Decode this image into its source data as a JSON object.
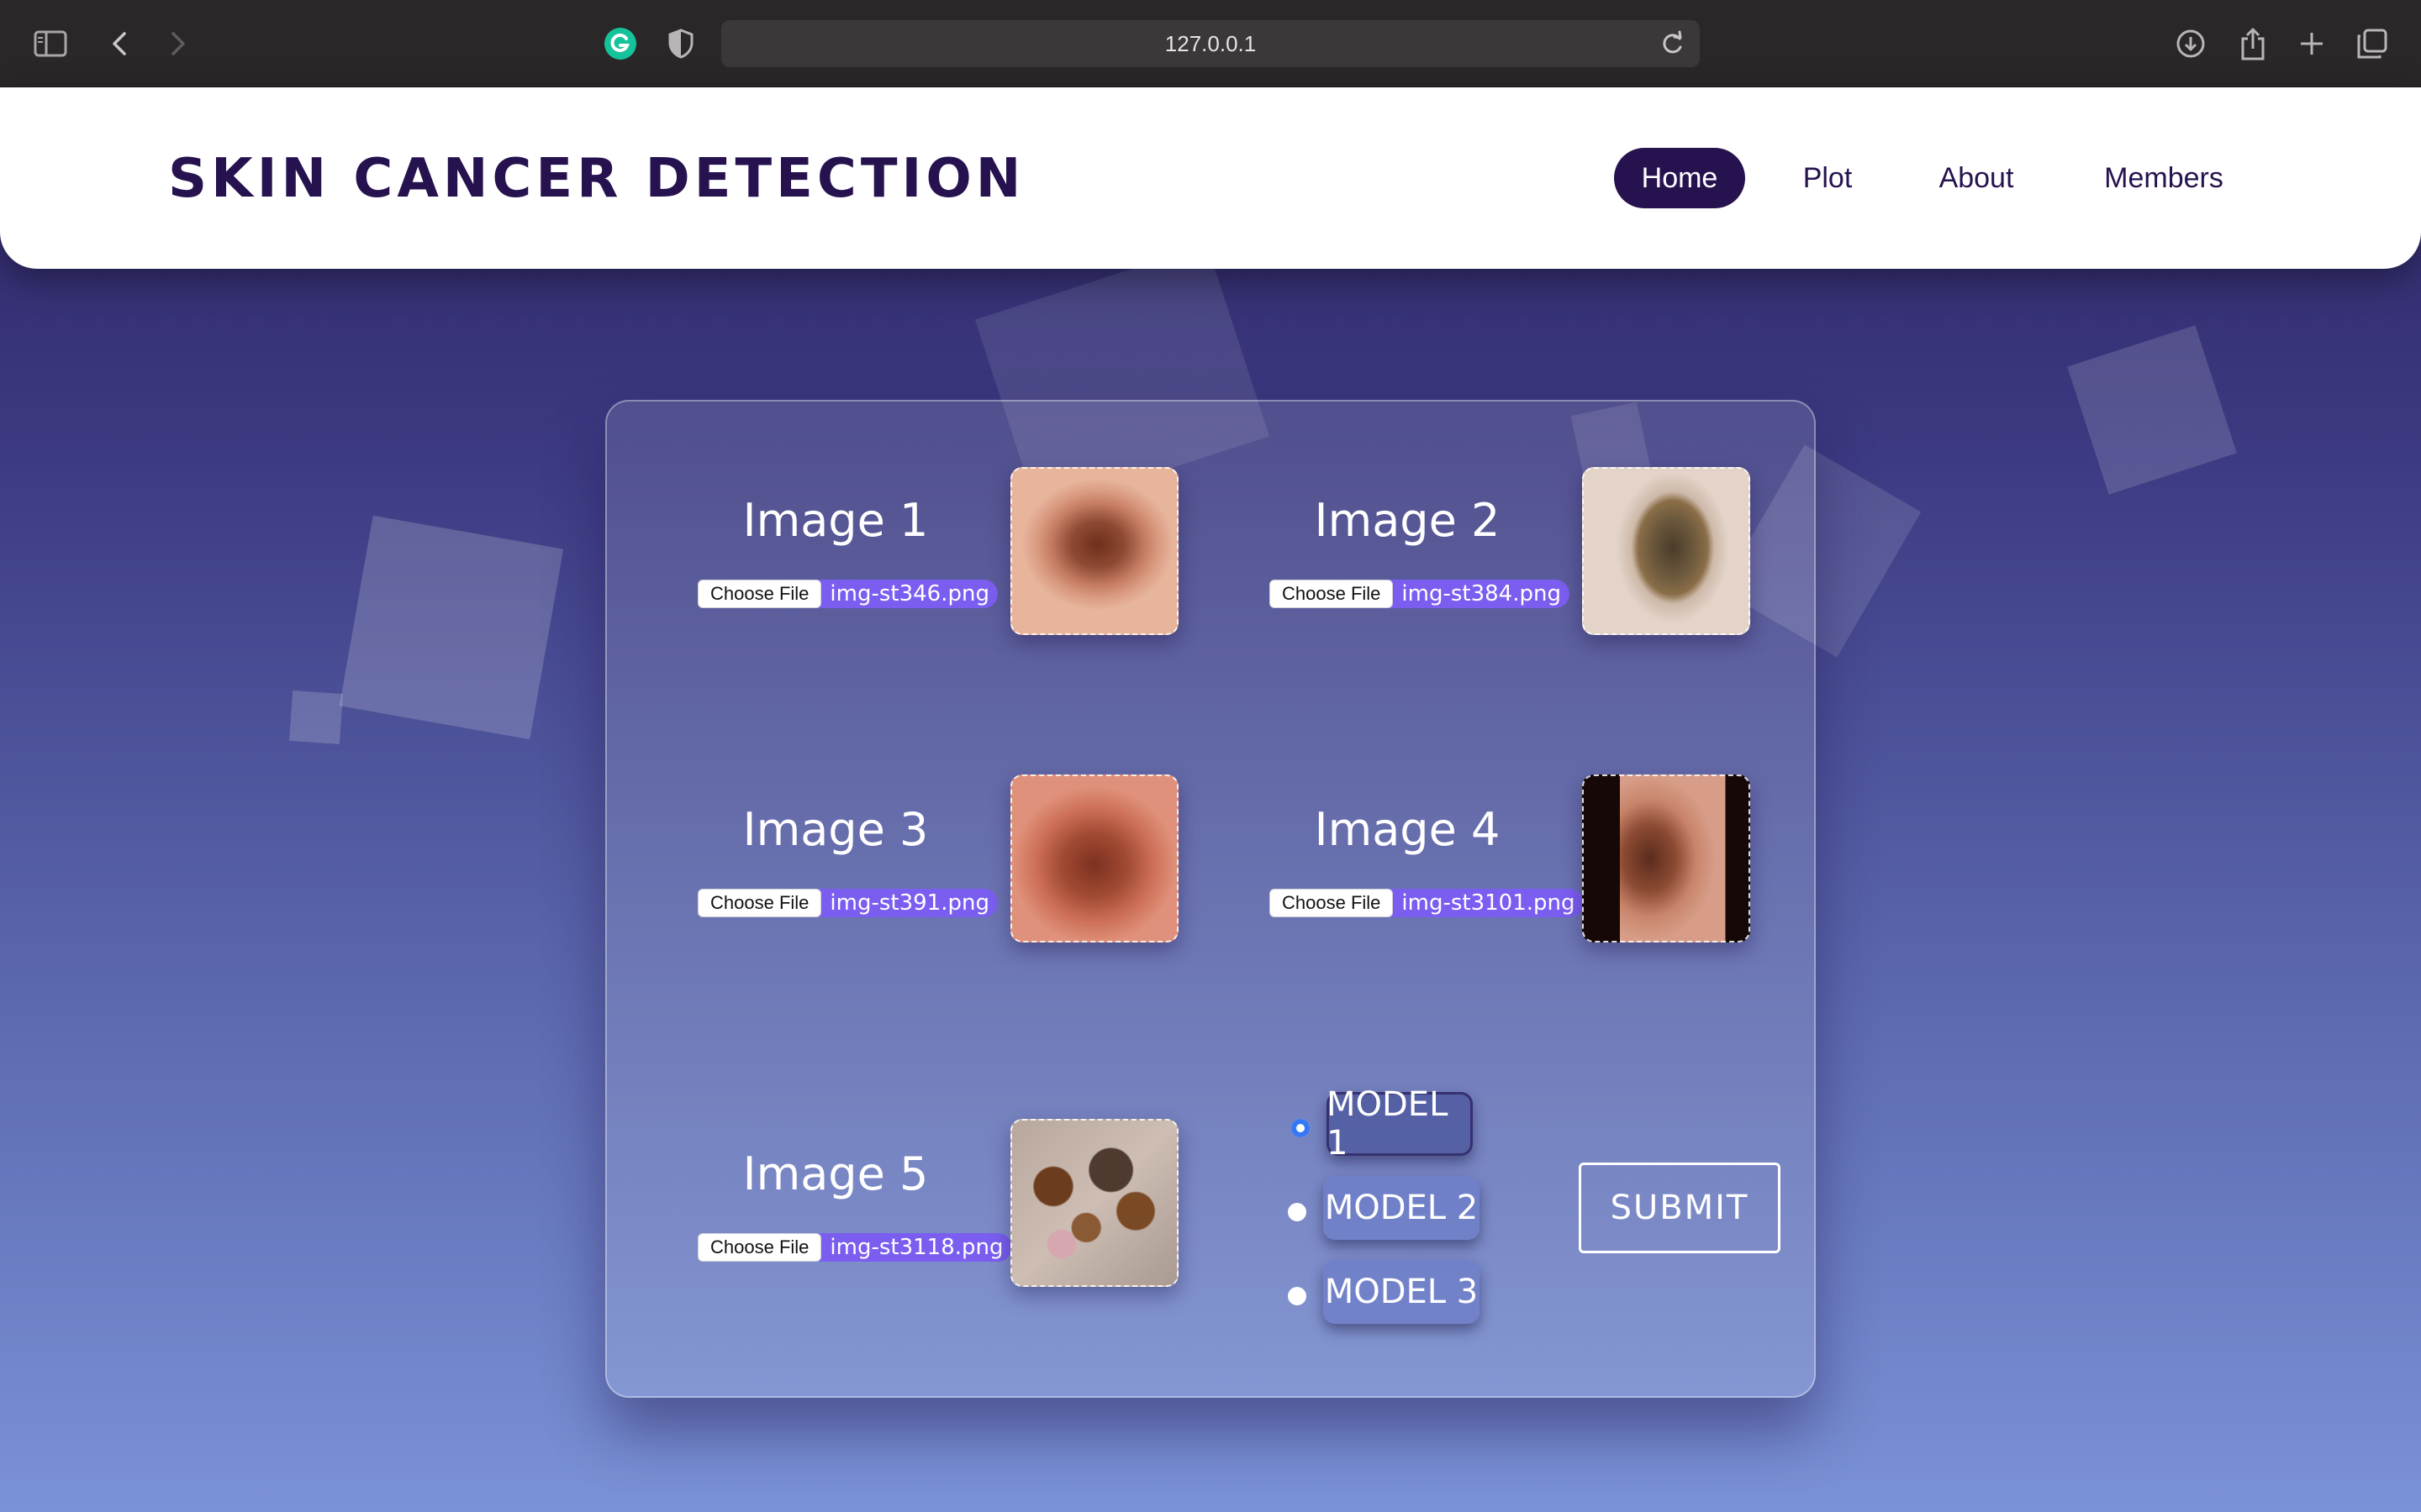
{
  "browser": {
    "url": "127.0.0.1"
  },
  "header": {
    "brand": "SKIN CANCER DETECTION",
    "nav": [
      {
        "label": "Home",
        "active": true
      },
      {
        "label": "Plot",
        "active": false
      },
      {
        "label": "About",
        "active": false
      },
      {
        "label": "Members",
        "active": false
      }
    ]
  },
  "form": {
    "choose_label": "Choose File",
    "slots": [
      {
        "title": "Image 1",
        "file": "img-st346.png"
      },
      {
        "title": "Image 2",
        "file": "img-st384.png"
      },
      {
        "title": "Image 3",
        "file": "img-st391.png"
      },
      {
        "title": "Image 4",
        "file": "img-st3101.png"
      },
      {
        "title": "Image 5",
        "file": "img-st3118.png"
      }
    ],
    "models": [
      {
        "label": "MODEL 1",
        "selected": true
      },
      {
        "label": "MODEL 2",
        "selected": false
      },
      {
        "label": "MODEL 3",
        "selected": false
      }
    ],
    "submit_label": "SUBMIT"
  },
  "colors": {
    "brand": "#26124f",
    "file_accent": "#7b5ef0",
    "radio_checked": "#3478f6"
  }
}
